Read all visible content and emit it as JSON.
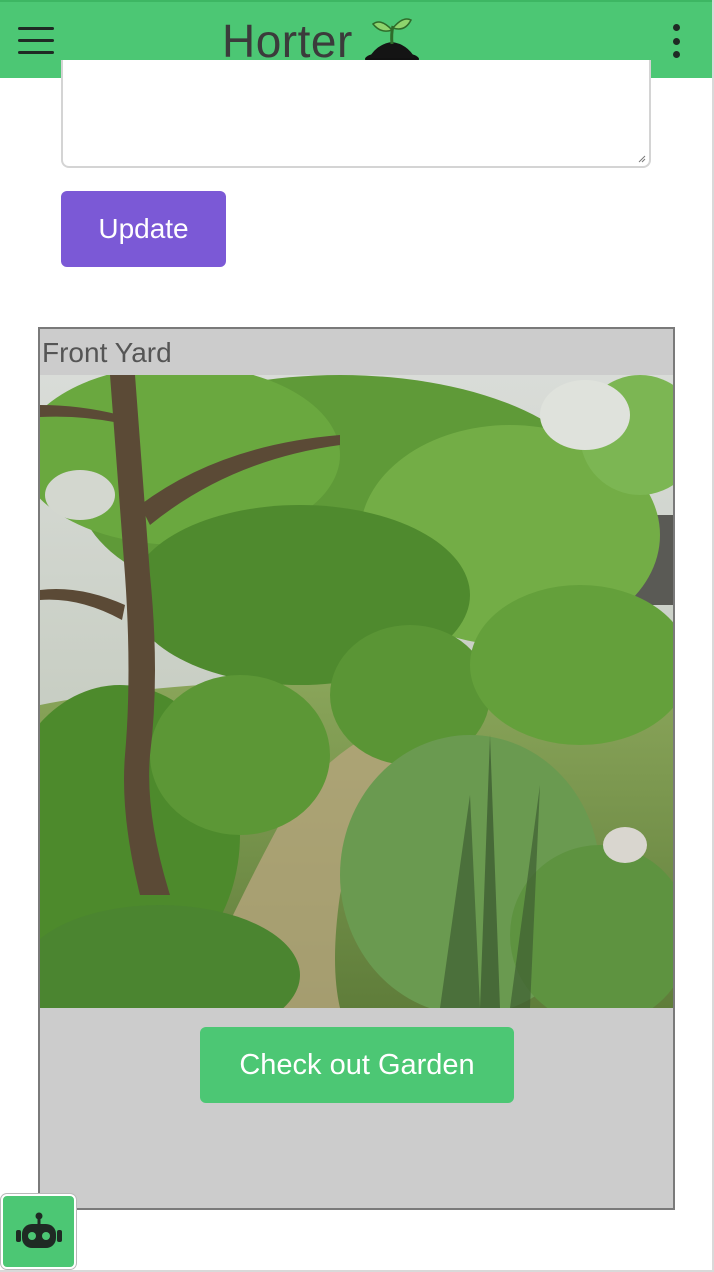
{
  "app": {
    "title": "Horter",
    "logo_icon": "sprout-in-soil-icon",
    "menu_icon": "hamburger-menu-icon",
    "overflow_icon": "vertical-dots-icon"
  },
  "form": {
    "notes_value": "",
    "update_label": "Update"
  },
  "garden_card": {
    "name": "Front Yard",
    "photo_icon": "garden-photo",
    "button_label": "Check out Garden"
  },
  "assistant": {
    "icon": "robot-icon"
  },
  "colors": {
    "appbar": "#4cc774",
    "primary_button": "#7b59d6",
    "success_button": "#4cc774",
    "card_background": "#cccccc"
  }
}
